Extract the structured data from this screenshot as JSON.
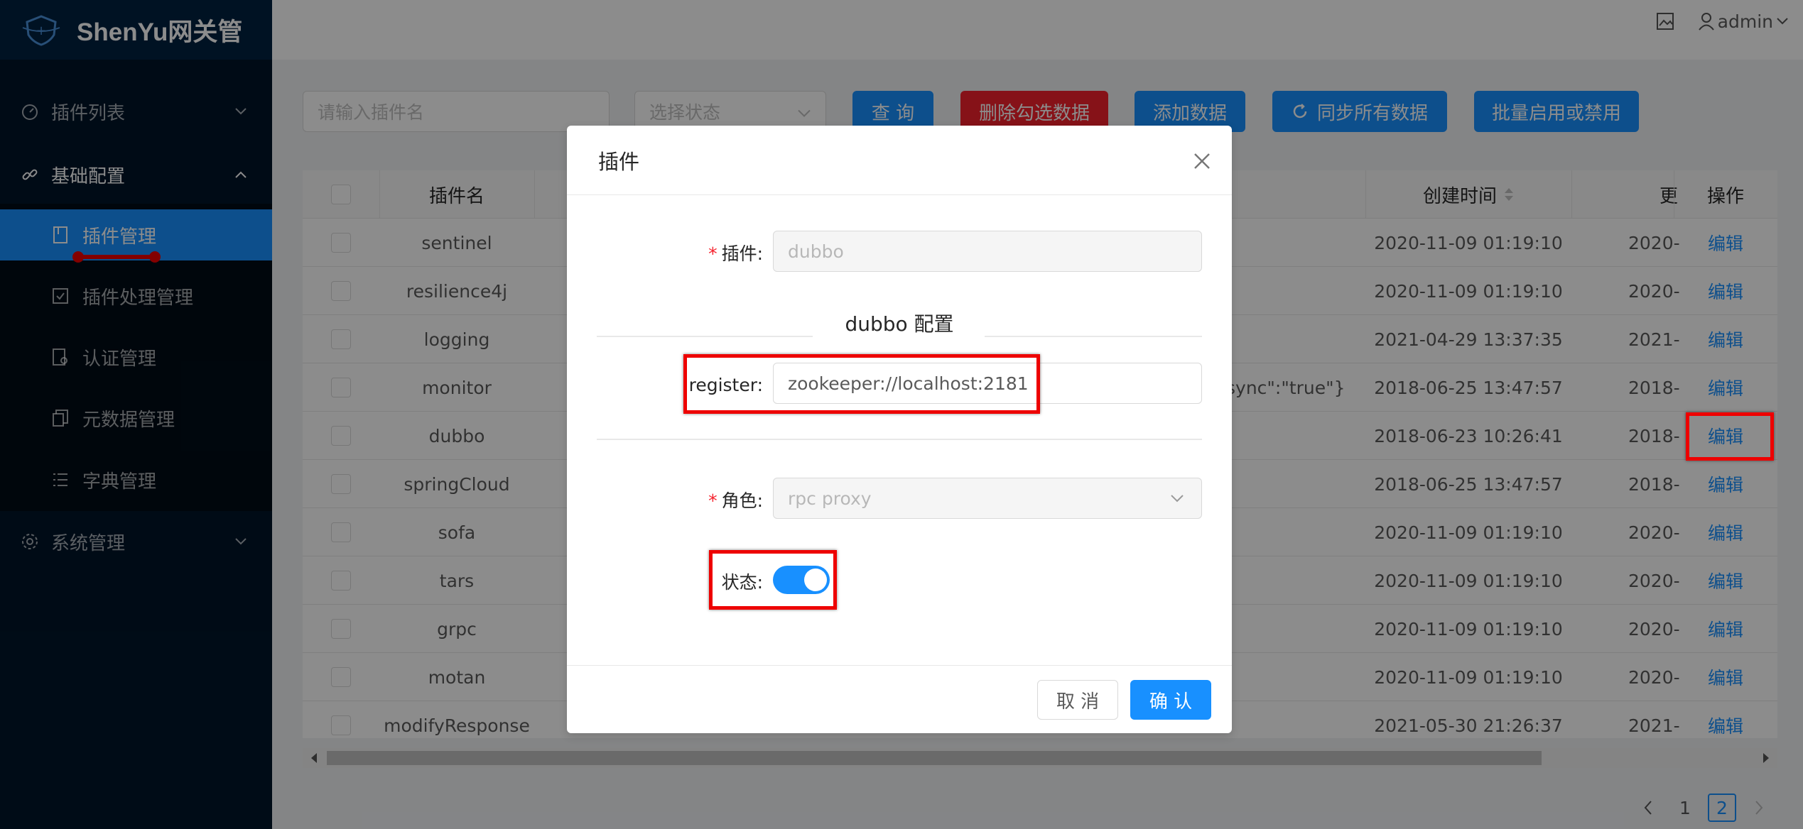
{
  "app": {
    "title": "ShenYu网关管"
  },
  "header": {
    "user": "admin"
  },
  "sidebar": {
    "items": [
      {
        "label": "插件列表",
        "icon": "dashboard-icon"
      },
      {
        "label": "基础配置",
        "icon": "link-icon"
      },
      {
        "label": "系统管理",
        "icon": "gear-icon"
      }
    ],
    "subitems": [
      {
        "label": "插件管理",
        "icon": "file-icon",
        "active": true
      },
      {
        "label": "插件处理管理",
        "icon": "check-square-icon"
      },
      {
        "label": "认证管理",
        "icon": "audit-icon"
      },
      {
        "label": "元数据管理",
        "icon": "copy-icon"
      },
      {
        "label": "字典管理",
        "icon": "list-icon"
      }
    ]
  },
  "toolbar": {
    "search_placeholder": "请输入插件名",
    "status_placeholder": "选择状态",
    "query": "查 询",
    "delete_selected": "删除勾选数据",
    "add": "添加数据",
    "sync_all": "同步所有数据",
    "batch_toggle": "批量启用或禁用"
  },
  "table": {
    "headers": {
      "name": "插件名",
      "created": "创建时间",
      "updated": "更",
      "action": "操作"
    },
    "edit_label": "编辑",
    "rows": [
      {
        "name": "sentinel",
        "config": "",
        "created": "2020-11-09 01:19:10",
        "updated": "2020-"
      },
      {
        "name": "resilience4j",
        "config": "",
        "created": "2020-11-09 01:19:10",
        "updated": "2020-"
      },
      {
        "name": "logging",
        "config": "",
        "created": "2021-04-29 13:37:35",
        "updated": "2021-"
      },
      {
        "name": "monitor",
        "config": "sync\":\"true\"}",
        "created": "2018-06-25 13:47:57",
        "updated": "2018-"
      },
      {
        "name": "dubbo",
        "config": "",
        "created": "2018-06-23 10:26:41",
        "updated": "2018-"
      },
      {
        "name": "springCloud",
        "config": "",
        "created": "2018-06-25 13:47:57",
        "updated": "2018-"
      },
      {
        "name": "sofa",
        "config": "",
        "created": "2020-11-09 01:19:10",
        "updated": "2020-"
      },
      {
        "name": "tars",
        "config": "",
        "created": "2020-11-09 01:19:10",
        "updated": "2020-"
      },
      {
        "name": "grpc",
        "config": "",
        "created": "2020-11-09 01:19:10",
        "updated": "2020-"
      },
      {
        "name": "motan",
        "config": "",
        "created": "2020-11-09 01:19:10",
        "updated": "2020-"
      },
      {
        "name": "modifyResponse",
        "config": "",
        "created": "2021-05-30 21:26:37",
        "updated": "2021-"
      }
    ]
  },
  "pagination": {
    "pages": [
      "1",
      "2"
    ],
    "current": "2"
  },
  "modal": {
    "title": "插件",
    "plugin_label": "插件:",
    "plugin_value": "dubbo",
    "section_title": "dubbo 配置",
    "register_label": "register:",
    "register_value": "zookeeper://localhost:2181",
    "role_label": "角色:",
    "role_value": "rpc proxy",
    "status_label": "状态:",
    "status_on": true,
    "cancel": "取 消",
    "ok": "确 认"
  },
  "colors": {
    "primary": "#1890ff",
    "danger": "#f5222d",
    "sidebar": "#001529",
    "annotation": "#e00000"
  }
}
